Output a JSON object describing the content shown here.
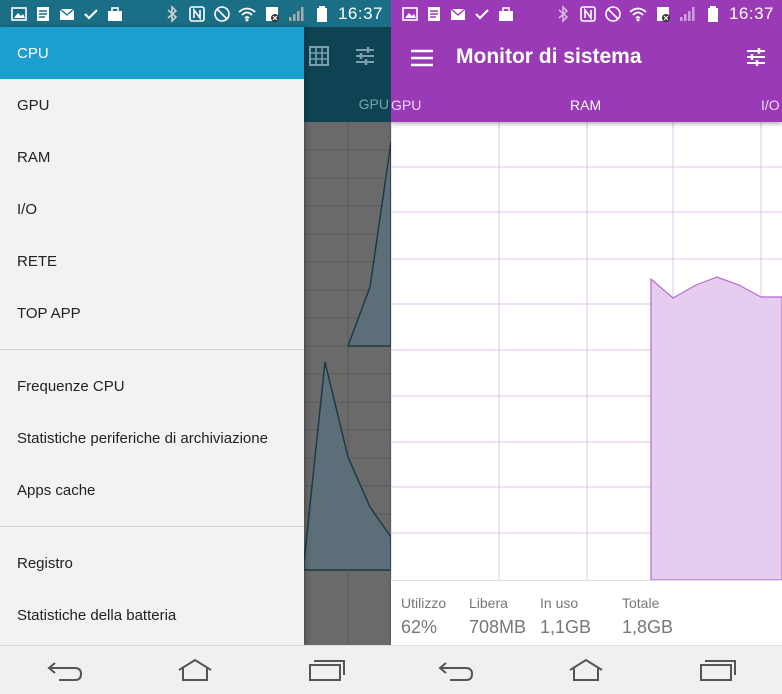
{
  "status_bar": {
    "time": "16:37"
  },
  "left_screen": {
    "underlying_tab_label": "GPU",
    "drawer": {
      "section1": [
        "CPU",
        "GPU",
        "RAM",
        "I/O",
        "RETE",
        "TOP APP"
      ],
      "section2": [
        "Frequenze CPU",
        "Statistiche periferiche di archiviazione",
        "Apps cache"
      ],
      "section3": [
        "Registro",
        "Statistiche della batteria"
      ],
      "active_item": "CPU"
    }
  },
  "right_screen": {
    "app_title": "Monitor di sistema",
    "tabs": [
      "GPU",
      "RAM",
      "I/O"
    ],
    "active_tab": "RAM",
    "stats": [
      {
        "label": "Utilizzo",
        "value": "62%"
      },
      {
        "label": "Libera",
        "value": "708MB"
      },
      {
        "label": "In uso",
        "value": "1,1GB"
      },
      {
        "label": "Totale",
        "value": "1,8GB"
      }
    ]
  },
  "colors": {
    "accent_purple": "#9b3ab6",
    "drawer_active_blue": "#1b9fd0",
    "underlying_toolbar": "#0f4354",
    "chart_fill": "#e6cdf0",
    "chart_line": "#b868d0"
  },
  "icons": [
    "image-icon",
    "document-icon",
    "mail-icon",
    "check-icon",
    "briefcase-icon",
    "bluetooth-icon",
    "nfc-icon",
    "mute-icon",
    "wifi-icon",
    "sim-icon",
    "signal-icon",
    "battery-icon",
    "menu-icon",
    "tune-icon",
    "grid-icon",
    "back-icon",
    "home-icon",
    "recents-icon"
  ]
}
